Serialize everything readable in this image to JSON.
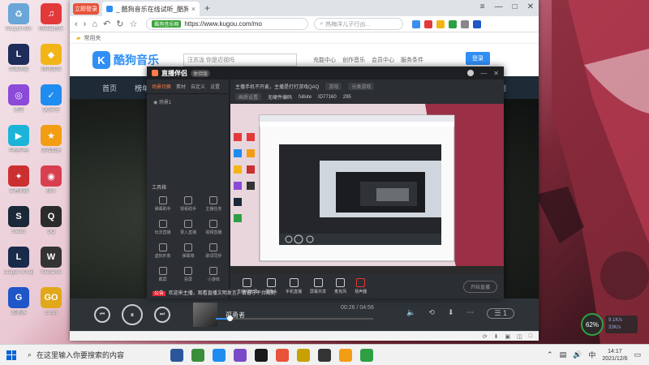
{
  "desktop": {
    "icons": [
      {
        "label": "Recycle Bin",
        "color": "#6aa6d8",
        "glyph": "♻"
      },
      {
        "label": "网易云音乐",
        "color": "#e23a3a",
        "glyph": "♫"
      },
      {
        "label": "英雄联盟",
        "color": "#1e2c5a",
        "glyph": "L"
      },
      {
        "label": "腾讯游戏",
        "color": "#f2b417",
        "glyph": "◆"
      },
      {
        "label": "迅雷",
        "color": "#8b4ad8",
        "glyph": "◎"
      },
      {
        "label": "QQ安全",
        "color": "#1f8cf0",
        "glyph": "✓"
      },
      {
        "label": "哔哩哔哩",
        "color": "#1bb4d8",
        "glyph": "▶"
      },
      {
        "label": "游戏加速",
        "color": "#f29d14",
        "glyph": "★"
      },
      {
        "label": "王者荣耀",
        "color": "#cc2f2f",
        "glyph": "✦"
      },
      {
        "label": "战斗",
        "color": "#d83f4f",
        "glyph": "◉"
      },
      {
        "label": "Steam",
        "color": "#1b2838",
        "glyph": "S"
      },
      {
        "label": "QQ",
        "color": "#2b2b2b",
        "glyph": "Q"
      },
      {
        "label": "League of Legends",
        "color": "#1a2a4a",
        "glyph": "L"
      },
      {
        "label": "WeGame",
        "color": "#333333",
        "glyph": "W"
      },
      {
        "label": "加速器",
        "color": "#1f56c8",
        "glyph": "G"
      },
      {
        "label": "cs go",
        "color": "#e0a81a",
        "glyph": "GO"
      }
    ]
  },
  "browser": {
    "tab_title": "_ 酷狗音乐在线试听_酷狗音乐…",
    "new_tab": "+",
    "logo_badge": "立即登录",
    "url_badge": "酷狗音乐网",
    "url": "https://www.kugou.com/mo",
    "search_placeholder": "热梅洋儿子行凶…",
    "bookmark": "常用夹",
    "status_items": [
      "⟳",
      "⬇",
      "▣",
      "◫",
      "□"
    ]
  },
  "kugou": {
    "logo_mark": "K",
    "logo_text": "酷狗音乐",
    "search_placeholder": "汪苏泷 你是近视吗",
    "links": [
      "充能中心",
      "创作音乐",
      "会员中心",
      "服务条件"
    ],
    "login": "登录",
    "nav": [
      "首页",
      "榜单"
    ],
    "nav_right": "计划",
    "player": {
      "prev": "⏮",
      "play": "⏸",
      "next": "⏭",
      "song": "孤勇者",
      "time": "00:26 / 04:56",
      "progress": 0.09,
      "quality": "1"
    }
  },
  "live": {
    "logo": "直播伴侣",
    "version": "体验版",
    "tabs": [
      "场景切换",
      "素材",
      "自定义",
      "设置"
    ],
    "scene": "场景1",
    "title_row": "主播手机不开麦，主播是打打游戏QAQ",
    "tags": [
      "游戏",
      "分类游戏"
    ],
    "info_row": [
      "画质设置",
      "无硬件编码",
      "fullute",
      "ID77160",
      "295"
    ],
    "tools_title": "工具箱",
    "tools": [
      "弹幕助手",
      "观看助手",
      "主播任务",
      "玩法直播",
      "录入直播",
      "视频直播",
      "虚拟形象",
      "弹幕墙",
      "歌词同步",
      "截屏",
      "投屏",
      "小游戏"
    ],
    "bottom": [
      "直播间管理",
      "摄像头",
      "手机直播",
      "屏幕共享",
      "麦克风",
      "扬声器"
    ],
    "start": "开始直播",
    "notice_tag": "公告",
    "notice": "欢迎来主播，观看直播文明发言，请遵守平台规则"
  },
  "taskbar": {
    "search_placeholder": "在这里输入你要搜索的内容",
    "clock_time": "14:17",
    "clock_date": "2021/12/6",
    "ime": "中",
    "apps": [
      "#2b579a",
      "#3b8f3b",
      "#1f8cf0",
      "#7a4bc8",
      "#1a1a1a",
      "#e8533a",
      "#c8a000",
      "#333333",
      "#f29d14",
      "#2ea043"
    ]
  },
  "perf": {
    "percent": "62%",
    "up": "9.1K/s",
    "down": "33K/s"
  }
}
